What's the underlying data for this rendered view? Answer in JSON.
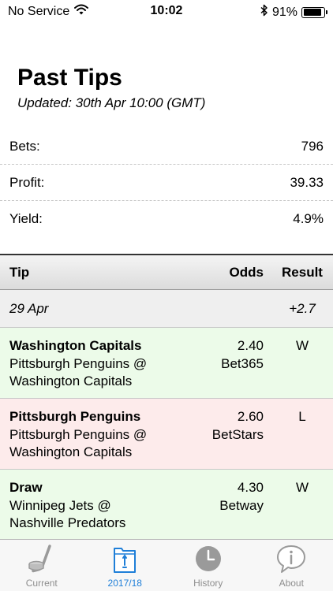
{
  "status_bar": {
    "carrier": "No Service",
    "time": "10:02",
    "battery_percent": "91%",
    "battery_level": 0.91
  },
  "header": {
    "title": "Past Tips",
    "updated": "Updated: 30th Apr 10:00 (GMT)"
  },
  "stats": [
    {
      "label": "Bets:",
      "value": "796"
    },
    {
      "label": "Profit:",
      "value": "39.33"
    },
    {
      "label": "Yield:",
      "value": "4.9%"
    }
  ],
  "table": {
    "headers": {
      "tip": "Tip",
      "odds": "Odds",
      "result": "Result"
    },
    "day": {
      "date": "29 Apr",
      "total": "+2.7"
    },
    "rows": [
      {
        "pick": "Washington Capitals",
        "match_line1": "Pittsburgh Penguins @",
        "match_line2": "Washington Capitals",
        "odds": "2.40",
        "bookmaker": "Bet365",
        "result": "W"
      },
      {
        "pick": "Pittsburgh Penguins",
        "match_line1": "Pittsburgh Penguins @",
        "match_line2": "Washington Capitals",
        "odds": "2.60",
        "bookmaker": "BetStars",
        "result": "L"
      },
      {
        "pick": "Draw",
        "match_line1": "Winnipeg Jets @",
        "match_line2": "Nashville Predators",
        "odds": "4.30",
        "bookmaker": "Betway",
        "result": "W"
      }
    ]
  },
  "tabs": [
    {
      "label": "Current",
      "icon": "hockey-icon"
    },
    {
      "label": "2017/18",
      "icon": "folder-icon"
    },
    {
      "label": "History",
      "icon": "clock-icon"
    },
    {
      "label": "About",
      "icon": "info-icon"
    }
  ],
  "colors": {
    "accent": "#1f7fd8",
    "win_row": "#ecfbe9",
    "loss_row": "#fdebeb",
    "inactive_tab": "#8e8e8e"
  }
}
